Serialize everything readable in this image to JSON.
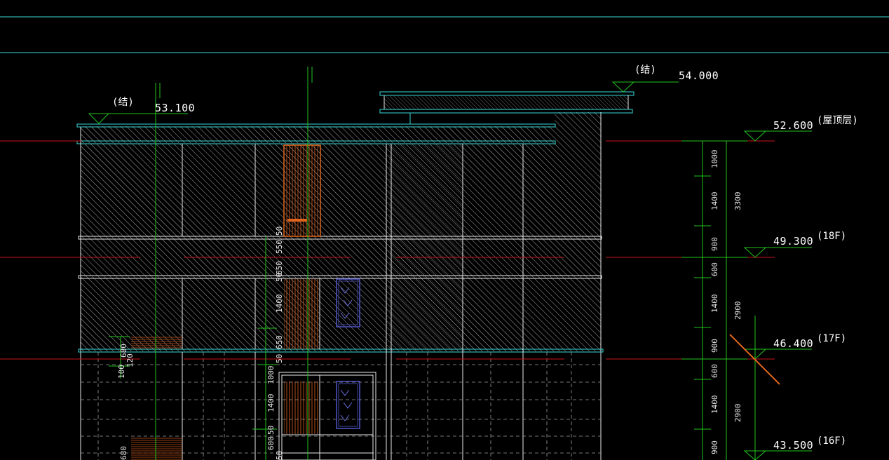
{
  "colors": {
    "background": "#000000",
    "cyan": "#39d7d7",
    "green": "#22c41e",
    "red": "#c8141a",
    "white": "#e8e8e8",
    "orange": "#e0651c",
    "blue": "#5055c8"
  },
  "elevations_right": [
    {
      "value": "52.600",
      "label": "(屋顶层)"
    },
    {
      "value": "49.300",
      "label": "(18F)"
    },
    {
      "value": "46.400",
      "label": "(17F)"
    },
    {
      "value": "43.500",
      "label": "(16F)"
    }
  ],
  "elevations_top": [
    {
      "value": "53.100",
      "label": "(结)"
    },
    {
      "value": "54.000",
      "label": "(结)"
    }
  ],
  "right_dims_fine": [
    "1000",
    "1400",
    "900",
    "600",
    "1400",
    "900",
    "600",
    "1400",
    "900"
  ],
  "right_dims_total": [
    "3300",
    "2900",
    "2900"
  ],
  "center_dims": [
    "50",
    "550",
    "650",
    "50",
    "1400",
    "650",
    "50",
    "1000",
    "1400",
    "50",
    "600",
    "50"
  ],
  "left_dims": [
    "680",
    "120",
    "100",
    "680"
  ]
}
